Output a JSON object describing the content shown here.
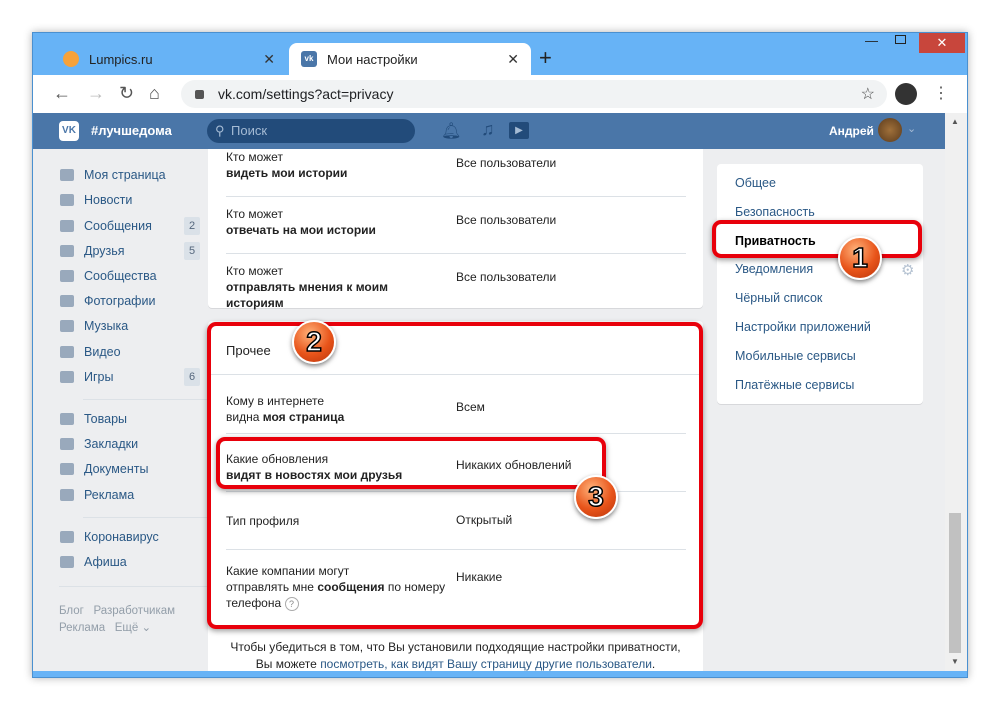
{
  "browser": {
    "tabs": [
      {
        "label": "Lumpics.ru"
      },
      {
        "label": "Мои настройки"
      }
    ],
    "new_tab": "+",
    "url": "vk.com/settings?act=privacy"
  },
  "vk": {
    "hashtag": "#лучшедома",
    "search_placeholder": "Поиск",
    "user": "Андрей"
  },
  "sidebar": {
    "items": [
      {
        "label": "Моя страница",
        "icon": "home-icon"
      },
      {
        "label": "Новости",
        "icon": "news-icon"
      },
      {
        "label": "Сообщения",
        "badge": "2",
        "icon": "messages-icon"
      },
      {
        "label": "Друзья",
        "badge": "5",
        "icon": "friends-icon"
      },
      {
        "label": "Сообщества",
        "icon": "groups-icon"
      },
      {
        "label": "Фотографии",
        "icon": "camera-icon"
      },
      {
        "label": "Музыка",
        "icon": "music-icon"
      },
      {
        "label": "Видео",
        "icon": "video-icon"
      },
      {
        "label": "Игры",
        "badge": "6",
        "icon": "games-icon"
      },
      {
        "label": "Товары",
        "icon": "bag-icon"
      },
      {
        "label": "Закладки",
        "icon": "star-icon"
      },
      {
        "label": "Документы",
        "icon": "document-icon"
      },
      {
        "label": "Реклама",
        "icon": "megaphone-icon"
      },
      {
        "label": "Коронавирус",
        "icon": "virus-icon"
      },
      {
        "label": "Афиша",
        "icon": "play-icon"
      }
    ],
    "footer": [
      "Блог",
      "Разработчикам",
      "Реклама",
      "Ещё ⌄"
    ]
  },
  "stories": [
    {
      "l1": "Кто может",
      "l2": "видеть мои истории",
      "value": "Все пользователи"
    },
    {
      "l1": "Кто может",
      "l2": "отвечать на мои истории",
      "value": "Все пользователи"
    },
    {
      "l1": "Кто может",
      "l2": "отправлять мнения к моим историям",
      "value": "Все пользователи"
    }
  ],
  "other": {
    "title": "Прочее",
    "rows": [
      {
        "l1": "Кому в интернете",
        "l2a": "видна ",
        "l2b": "моя страница",
        "value": "Всем"
      },
      {
        "l1": "Какие обновления",
        "l2a": "",
        "l2b": "видят в новостях мои друзья",
        "value": "Никаких обновлений"
      },
      {
        "l1": "Тип профиля",
        "value": "Открытый"
      },
      {
        "l1": "Какие компании могут",
        "l2a": "отправлять мне ",
        "l2b": "сообщения",
        "l2c": " по номеру",
        "l3": "телефона",
        "value": "Никакие"
      }
    ]
  },
  "footer_note": {
    "line1": "Чтобы убедиться в том, что Вы установили подходящие настройки приватности,",
    "line2a": "Вы можете ",
    "link": "посмотреть, как видят Вашу страницу другие пользователи",
    "line2b": "."
  },
  "right_menu": [
    "Общее",
    "Безопасность",
    "Приватность",
    "Уведомления",
    "Чёрный список",
    "Настройки приложений",
    "Мобильные сервисы",
    "Платёжные сервисы"
  ],
  "annotations": [
    "1",
    "2",
    "3"
  ]
}
